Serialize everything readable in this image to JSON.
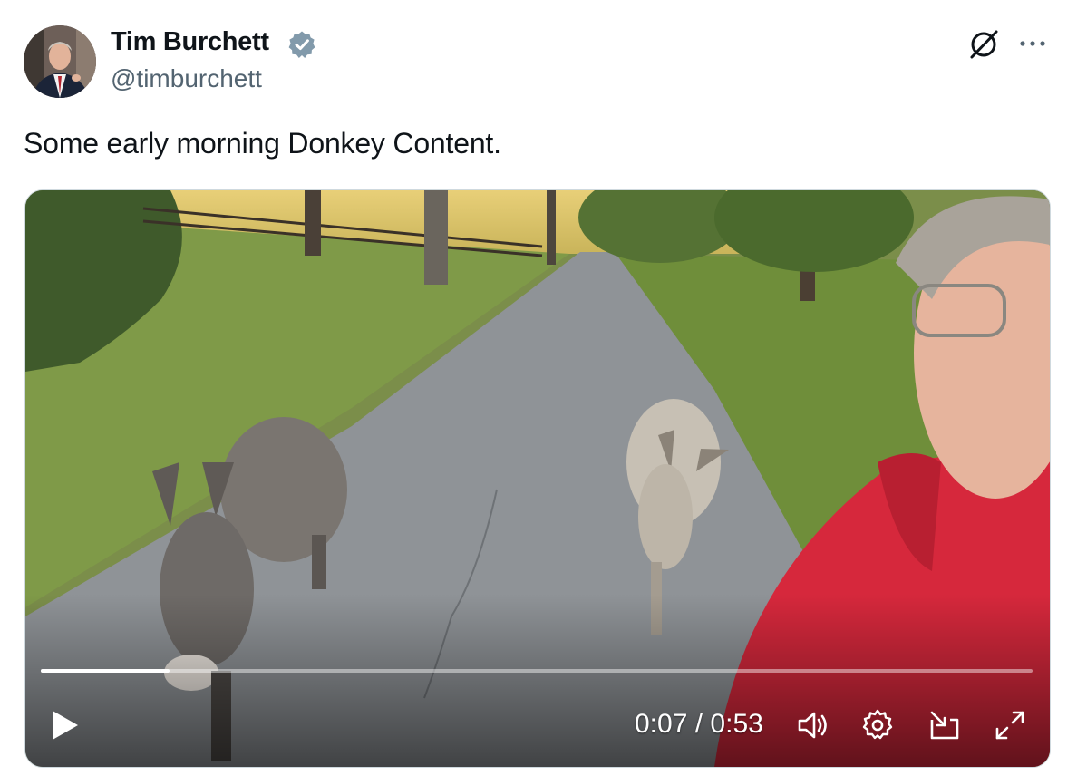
{
  "author": {
    "name": "Tim Burchett",
    "handle": "@timburchett",
    "verified": true
  },
  "tweet": {
    "text": "Some early morning Donkey Content."
  },
  "video": {
    "current_time": "0:07",
    "separator": "/",
    "duration": "0:53",
    "progress_fraction": 0.13
  },
  "icons": {
    "verified": "verified-badge-icon",
    "grok": "grok-icon",
    "more": "more-options-icon",
    "play": "play-icon",
    "volume": "volume-icon",
    "settings": "gear-icon",
    "pip": "picture-in-picture-icon",
    "fullscreen": "fullscreen-icon"
  },
  "colors": {
    "verified_badge": "#829aab",
    "secondary_text": "#536471",
    "primary_text": "#0f1419",
    "hoodie": "#d6283c"
  }
}
